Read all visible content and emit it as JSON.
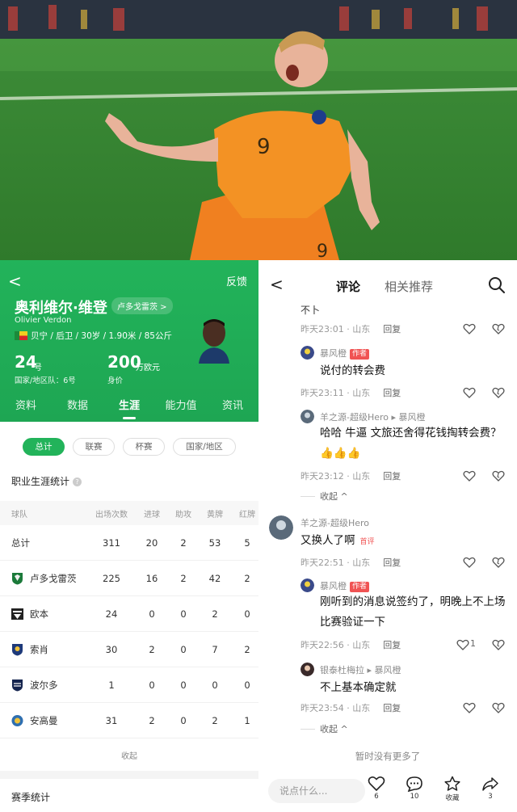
{
  "player": {
    "name": "奥利维尔·维登",
    "english_name": "Olivier Verdon",
    "club_tag": "卢多戈雷茨 >",
    "meta": "贝宁 / 后卫 / 30岁 / 1.90米 / 85公斤",
    "number": "24",
    "number_unit": "号",
    "number_label": "国家/地区队：6号",
    "value": "200",
    "value_unit": "万欧元",
    "value_label": "身价"
  },
  "header": {
    "back": "<",
    "feedback": "反馈"
  },
  "tabs": [
    {
      "label": "资料"
    },
    {
      "label": "数据"
    },
    {
      "label": "生涯",
      "active": true
    },
    {
      "label": "能力值"
    },
    {
      "label": "资讯"
    }
  ],
  "filters": [
    {
      "label": "总计",
      "active": true
    },
    {
      "label": "联赛"
    },
    {
      "label": "杯赛"
    },
    {
      "label": "国家/地区"
    }
  ],
  "career": {
    "title": "职业生涯统计",
    "help_glyph": "?",
    "headers": [
      "球队",
      "出场次数",
      "进球",
      "助攻",
      "黄牌",
      "红牌"
    ],
    "rows": [
      {
        "team": "总计",
        "apps": "311",
        "goals": "20",
        "assists": "2",
        "yellow": "53",
        "red": "5",
        "badge": ""
      },
      {
        "team": "卢多戈雷茨",
        "apps": "225",
        "goals": "16",
        "assists": "2",
        "yellow": "42",
        "red": "2",
        "badge": "ludogorets",
        "color": "#1b7a3a"
      },
      {
        "team": "欧本",
        "apps": "24",
        "goals": "0",
        "assists": "0",
        "yellow": "2",
        "red": "0",
        "badge": "eupen",
        "color": "#222222"
      },
      {
        "team": "索肖",
        "apps": "30",
        "goals": "2",
        "assists": "0",
        "yellow": "7",
        "red": "2",
        "badge": "sochaux",
        "color": "#1e3a7a"
      },
      {
        "team": "波尔多",
        "apps": "1",
        "goals": "0",
        "assists": "0",
        "yellow": "0",
        "red": "0",
        "badge": "bordeaux",
        "color": "#15254f"
      },
      {
        "team": "安高曼",
        "apps": "31",
        "goals": "2",
        "assists": "0",
        "yellow": "2",
        "red": "1",
        "badge": "angouleme",
        "color": "#2f6fb0"
      }
    ],
    "collapse": "收起"
  },
  "season": {
    "title": "赛季统计"
  },
  "comments_nav": {
    "tab_comments": "评论",
    "tab_related": "相关推荐"
  },
  "comments": [
    {
      "id": "c0",
      "text_fragment": "不卜",
      "time": "昨天23:01 · 山东",
      "reply": "回复"
    },
    {
      "id": "c1",
      "user": "暴风橙",
      "badge": "作者",
      "text": "说付的转会费",
      "time": "昨天23:11 · 山东",
      "reply": "回复"
    },
    {
      "id": "c2",
      "user": "羊之源-超级Hero ▸ 暴风橙",
      "text": "哈哈 牛逼 文旅还舍得花钱掏转会费？👍👍👍",
      "time": "昨天23:12 · 山东",
      "reply": "回复",
      "fold": "收起 ^"
    },
    {
      "id": "c3",
      "user": "羊之源-超级Hero",
      "text": "又换人了啊",
      "first": "首评",
      "time": "昨天22:51 · 山东",
      "reply": "回复"
    },
    {
      "id": "c4",
      "user": "暴风橙",
      "badge": "作者",
      "text": "刚听到的消息说签约了，明晚上不上场比赛验证一下",
      "time": "昨天22:56 · 山东",
      "reply": "回复",
      "likes": "1"
    },
    {
      "id": "c5",
      "user": "银泰杜梅拉 ▸ 暴风橙",
      "text": "不上基本确定就",
      "time": "昨天23:54 · 山东",
      "reply": "回复",
      "fold": "收起 ^"
    }
  ],
  "no_more": "暂时没有更多了",
  "bottom_bar": {
    "placeholder": "说点什么...",
    "likes": "6",
    "comments": "10",
    "favorite": "收藏",
    "shares": "3"
  },
  "colors": {
    "brand_green": "#22b35a",
    "author_red": "#f05353"
  }
}
